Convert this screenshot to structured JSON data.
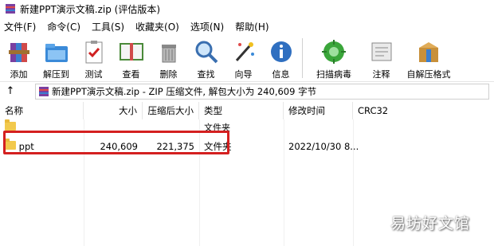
{
  "window": {
    "title": "新建PPT演示文稿.zip (评估版本)"
  },
  "menu": [
    "文件(F)",
    "命令(C)",
    "工具(S)",
    "收藏夹(O)",
    "选项(N)",
    "帮助(H)"
  ],
  "toolbar": {
    "add": "添加",
    "extract_to": "解压到",
    "test": "测试",
    "view": "查看",
    "delete": "删除",
    "find": "查找",
    "wizard": "向导",
    "info": "信息",
    "scan": "扫描病毒",
    "comment": "注释",
    "sfx": "自解压格式"
  },
  "address": {
    "path": "新建PPT演示文稿.zip - ZIP 压缩文件, 解包大小为 240,609 字节"
  },
  "columns": {
    "name": "名称",
    "size": "大小",
    "packed": "压缩后大小",
    "type": "类型",
    "mtime": "修改时间",
    "crc": "CRC32"
  },
  "rows": [
    {
      "name": "",
      "size": "",
      "packed": "",
      "type": "文件夹",
      "mtime": "",
      "crc": ""
    },
    {
      "name": "ppt",
      "size": "240,609",
      "packed": "221,375",
      "type": "文件夹",
      "mtime": "2022/10/30 8...",
      "crc": ""
    }
  ],
  "watermark": "易坊好文馆",
  "colors": {
    "highlight": "#d42020",
    "folder": "#f2c94c"
  }
}
